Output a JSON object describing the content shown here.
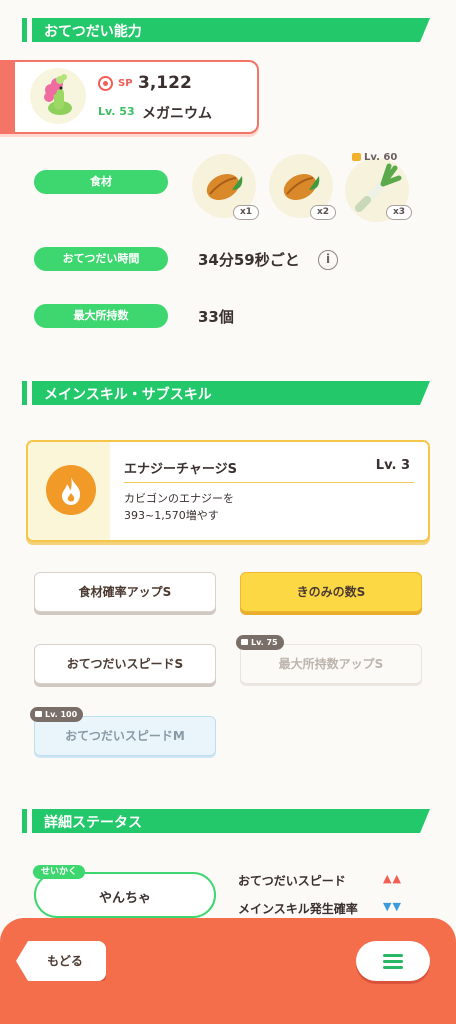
{
  "sections": {
    "help_ability": "おてつだい能力",
    "skills": "メインスキル・サブスキル",
    "details": "詳細ステータス"
  },
  "pokemon": {
    "sp_label": "SP",
    "sp_value": "3,122",
    "level": "Lv. 53",
    "name": "メガニウム",
    "sprite_icon": "meganium-sprite"
  },
  "help_stats": {
    "ingredients_label": "食材",
    "ingredients": [
      {
        "icon": "cacao-bean-icon",
        "qty": "x1"
      },
      {
        "icon": "cacao-bean-icon",
        "qty": "x2"
      },
      {
        "icon": "leek-icon",
        "qty": "x3",
        "lock_level": "Lv. 60"
      }
    ],
    "help_time_label": "おてつだい時間",
    "help_time_value": "34分59秒ごと",
    "max_carry_label": "最大所持数",
    "max_carry_value": "33個"
  },
  "main_skill": {
    "name": "エナジーチャージS",
    "level": "Lv. 3",
    "description_line1": "カビゴンのエナジーを",
    "description_line2": "393~1,570増やす",
    "icon": "flame-icon"
  },
  "sub_skills": [
    {
      "label": "食材確率アップS"
    },
    {
      "label": "きのみの数S"
    },
    {
      "label": "おてつだいスピードS"
    },
    {
      "label": "最大所持数アップS",
      "lock_level": "Lv. 75"
    },
    {
      "label": "おてつだいスピードM",
      "lock_level": "Lv. 100"
    }
  ],
  "details": {
    "nature_tag": "せいかく",
    "nature_value": "やんちゃ",
    "effect_up_label": "おてつだいスピード",
    "effect_up_arrows": "▲▲",
    "effect_down_label": "メインスキル発生確率",
    "effect_down_arrows": "▼▼"
  },
  "footer": {
    "back_label": "もどる",
    "menu_icon": "hamburger-menu-icon"
  },
  "colors": {
    "accent_green": "#22c86a",
    "coral": "#f56e4c",
    "gold": "#fbd844",
    "up_red": "#f45d54",
    "down_blue": "#3b9bdc"
  }
}
